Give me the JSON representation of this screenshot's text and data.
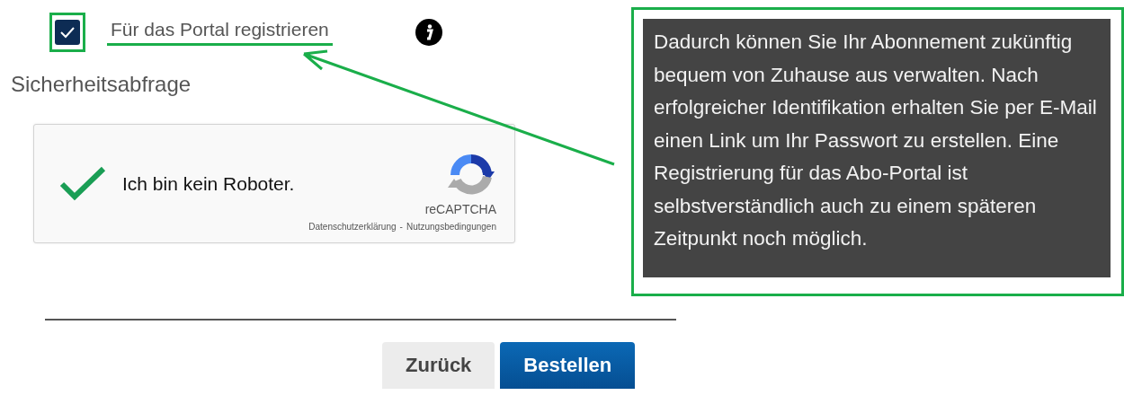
{
  "register": {
    "label": "Für das Portal registrieren",
    "checked": true
  },
  "security": {
    "title": "Sicherheitsabfrage"
  },
  "captcha": {
    "checked": true,
    "label": "Ich bin kein Roboter.",
    "brand": "reCAPTCHA",
    "privacy": "Datenschutzerklärung",
    "separator": "-",
    "terms": "Nutzungsbedingungen"
  },
  "buttons": [
    {
      "label": "Zurück",
      "kind": "secondary"
    },
    {
      "label": "Bestellen",
      "kind": "primary"
    }
  ],
  "tooltip": {
    "text": "Dadurch können Sie Ihr Abonnement zukünftig bequem von Zuhause aus verwalten. Nach erfolgreicher Identifikation erhalten Sie per E-Mail einen Link um Ihr Passwort zu erstellen. Eine Registrierung für das Abo-Portal ist selbstverständlich auch zu einem späteren Zeitpunkt noch möglich."
  }
}
